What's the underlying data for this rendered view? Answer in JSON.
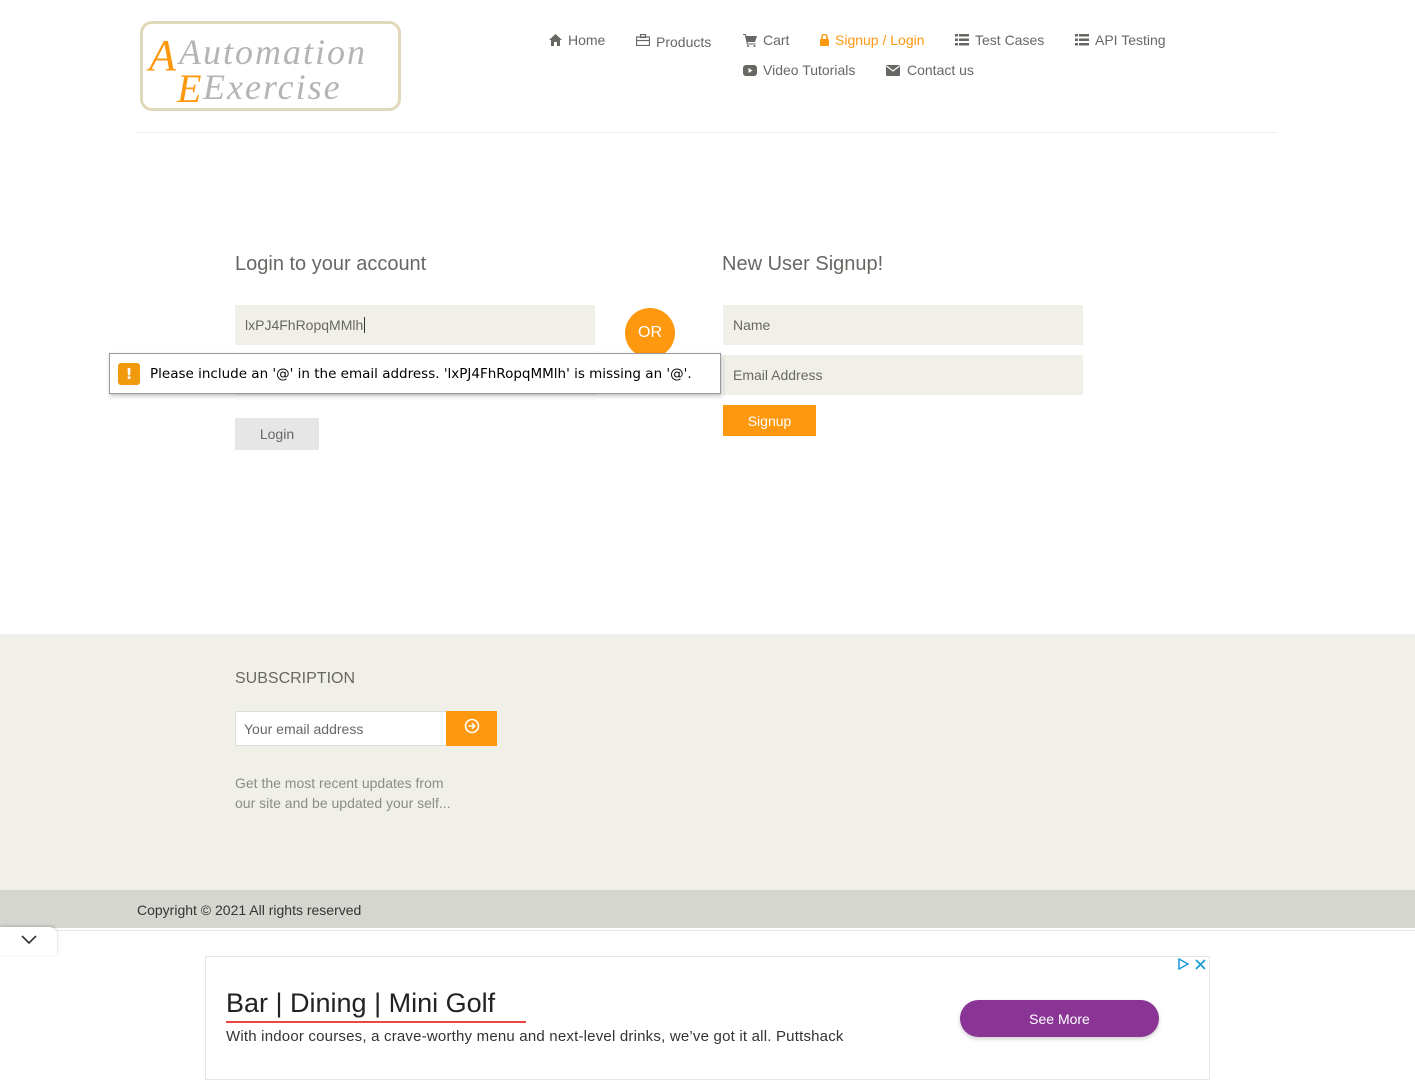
{
  "logo": {
    "text_line1": "Automation",
    "text_line2": "Exercise"
  },
  "nav": [
    {
      "label": "Home",
      "icon": "home-icon"
    },
    {
      "label": "Products",
      "icon": "briefcase-icon"
    },
    {
      "label": "Cart",
      "icon": "cart-icon"
    },
    {
      "label": "Signup / Login",
      "icon": "lock-icon",
      "active": true
    },
    {
      "label": "Test Cases",
      "icon": "list-icon"
    },
    {
      "label": "API Testing",
      "icon": "list-icon"
    },
    {
      "label": "Video Tutorials",
      "icon": "youtube-play-icon"
    },
    {
      "label": "Contact us",
      "icon": "envelope-icon"
    }
  ],
  "login": {
    "title": "Login to your account",
    "email_value": "lxPJ4FhRopqMMlh",
    "button": "Login"
  },
  "or_label": "OR",
  "validation_tooltip": "Please include an '@' in the email address. 'lxPJ4FhRopqMMlh' is missing an '@'.",
  "signup": {
    "title": "New User Signup!",
    "name_placeholder": "Name",
    "email_placeholder": "Email Address",
    "button": "Signup"
  },
  "subscription": {
    "title": "SUBSCRIPTION",
    "placeholder": "Your email address",
    "description": "Get the most recent updates from our site and be updated your self..."
  },
  "copyright": "Copyright © 2021 All rights reserved",
  "ad": {
    "title": "Bar | Dining | Mini Golf",
    "text": "With indoor courses, a crave-worthy menu and next-level drinks, we’ve got it all. Puttshack",
    "button": "See More"
  },
  "colors": {
    "accent": "#FE980F",
    "field_bg": "#F0F0E9",
    "ad_button": "#8a3596"
  }
}
